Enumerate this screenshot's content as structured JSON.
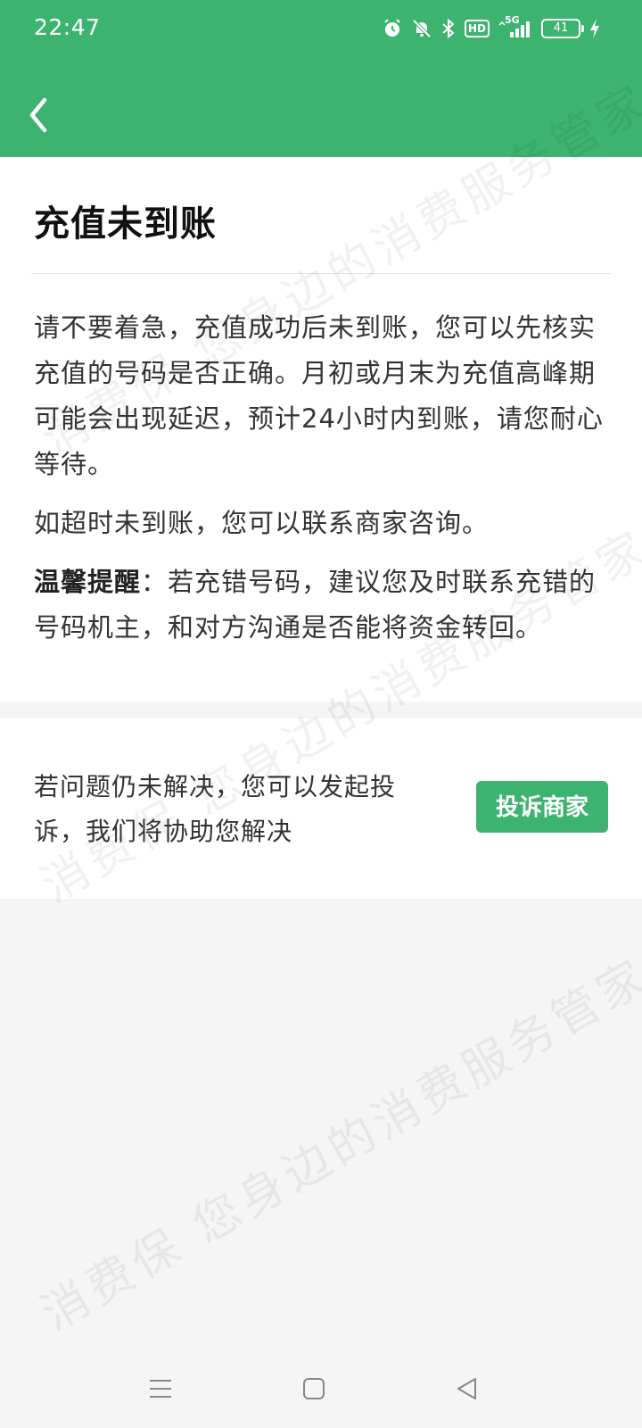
{
  "status_bar": {
    "time": "22:47",
    "network": "5G",
    "hd_badge": "HD",
    "battery": "41"
  },
  "header": {
    "back_icon": "chevron-left-icon",
    "color": "#3db370"
  },
  "main": {
    "title": "充值未到账",
    "paragraph1": "请不要着急，充值成功后未到账，您可以先核实充值的号码是否正确。月初或月末为充值高峰期可能会出现延迟，预计24小时内到账，请您耐心等待。",
    "paragraph2": "如超时未到账，您可以联系商家咨询。",
    "tip_label": "温馨提醒",
    "tip_text": "：若充错号码，建议您及时联系充错的号码机主，和对方沟通是否能将资金转回。"
  },
  "action": {
    "text": "若问题仍未解决，您可以发起投诉，我们将协助您解决",
    "button_label": "投诉商家"
  },
  "watermark": {
    "text": "消费保 您身边的消费服务管家"
  },
  "nav_bar": {
    "icons": [
      "menu-icon",
      "home-icon",
      "back-triangle-icon"
    ]
  }
}
